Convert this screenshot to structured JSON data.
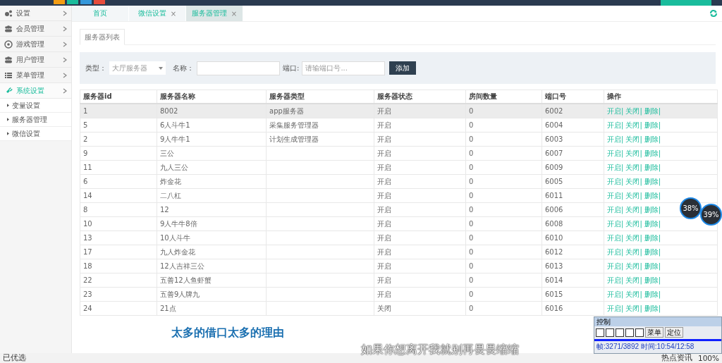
{
  "header": {
    "swatches": [
      {
        "color": "#f39c12"
      },
      {
        "color": "#1abc9c"
      },
      {
        "color": "#3498db"
      },
      {
        "color": "#e74c3c"
      }
    ]
  },
  "sidebar": {
    "items": [
      {
        "label": "设置",
        "kind": "gears",
        "selected": false
      },
      {
        "label": "会员管理",
        "kind": "users",
        "selected": false
      },
      {
        "label": "游戏管理",
        "kind": "ball",
        "selected": false
      },
      {
        "label": "用户管理",
        "kind": "users",
        "selected": false
      },
      {
        "label": "菜单管理",
        "kind": "list",
        "selected": false
      },
      {
        "label": "系统设置",
        "kind": "plug",
        "selected": true,
        "children": [
          {
            "label": "变量设置"
          },
          {
            "label": "服务器管理"
          },
          {
            "label": "微信设置"
          }
        ]
      }
    ]
  },
  "tabs": [
    {
      "label": "首页",
      "selected": false
    },
    {
      "label": "微信设置",
      "selected": false,
      "close": "×"
    },
    {
      "label": "服务器管理",
      "selected": true,
      "close": "×"
    }
  ],
  "panel_tab": "服务器列表",
  "filter": {
    "type_label": "类型：",
    "type_value": "大厅服务器",
    "name_label": "名称：",
    "port_label": "端口:",
    "port_placeholder": "请输端口号...",
    "add_button": "添加"
  },
  "table": {
    "columns": [
      "服务器id",
      "服务器名称",
      "服务器类型",
      "服务器状态",
      "房间数量",
      "端口号",
      "操作"
    ],
    "rows": [
      {
        "cells": [
          "1",
          "8002",
          "app服务器",
          "开启",
          "0",
          "6002"
        ],
        "actions": [
          "开启|",
          "关闭|",
          "删除|"
        ],
        "selected": true
      },
      {
        "cells": [
          "5",
          "6人斗牛1",
          "采集服务管理器",
          "开启",
          "0",
          "6004"
        ],
        "actions": [
          "开启|",
          "关闭|",
          "删除|"
        ],
        "selected": false
      },
      {
        "cells": [
          "2",
          "9人牛牛1",
          "计划生成管理器",
          "开启",
          "0",
          "6003"
        ],
        "actions": [
          "开启|",
          "关闭|",
          "删除|"
        ],
        "selected": false
      },
      {
        "cells": [
          "9",
          "三公",
          "",
          "开启",
          "0",
          "6007"
        ],
        "actions": [
          "开启|",
          "关闭|",
          "删除|"
        ],
        "selected": false
      },
      {
        "cells": [
          "11",
          "九人三公",
          "",
          "开启",
          "0",
          "6009"
        ],
        "actions": [
          "开启|",
          "关闭|",
          "删除|"
        ],
        "selected": false
      },
      {
        "cells": [
          "6",
          "炸金花",
          "",
          "开启",
          "0",
          "6005"
        ],
        "actions": [
          "开启|",
          "关闭|",
          "删除|"
        ],
        "selected": false
      },
      {
        "cells": [
          "14",
          "二八杠",
          "",
          "开启",
          "0",
          "6011"
        ],
        "actions": [
          "开启|",
          "关闭|",
          "删除|"
        ],
        "selected": false
      },
      {
        "cells": [
          "8",
          "12",
          "",
          "开启",
          "0",
          "6006"
        ],
        "actions": [
          "开启|",
          "关闭|",
          "删除|"
        ],
        "selected": false
      },
      {
        "cells": [
          "10",
          "9人牛牛8倍",
          "",
          "开启",
          "0",
          "6008"
        ],
        "actions": [
          "开启|",
          "关闭|",
          "删除|"
        ],
        "selected": false
      },
      {
        "cells": [
          "13",
          "10人斗牛",
          "",
          "开启",
          "0",
          "6010"
        ],
        "actions": [
          "开启|",
          "关闭|",
          "删除|"
        ],
        "selected": false
      },
      {
        "cells": [
          "17",
          "九人炸金花",
          "",
          "开启",
          "0",
          "6012"
        ],
        "actions": [
          "开启|",
          "关闭|",
          "删除|"
        ],
        "selected": false
      },
      {
        "cells": [
          "18",
          "12人吉祥三公",
          "",
          "开启",
          "0",
          "6013"
        ],
        "actions": [
          "开启|",
          "关闭|",
          "删除|"
        ],
        "selected": false
      },
      {
        "cells": [
          "22",
          "五善12人鱼虾蟹",
          "",
          "开启",
          "0",
          "6014"
        ],
        "actions": [
          "开启|",
          "关闭|",
          "删除|"
        ],
        "selected": false
      },
      {
        "cells": [
          "23",
          "五善9人牌九",
          "",
          "开启",
          "0",
          "6015"
        ],
        "actions": [
          "开启|",
          "关闭|",
          "删除|"
        ],
        "selected": false
      },
      {
        "cells": [
          "24",
          "21点",
          "",
          "关闭",
          "0",
          "6016"
        ],
        "actions": [
          "开启|",
          "关闭|",
          "删除|"
        ],
        "selected": false
      }
    ]
  },
  "gauges": [
    {
      "text": "38%"
    },
    {
      "text": "39%"
    }
  ],
  "subtitles": [
    "太多的借口太多的理由",
    "如果你想离开我就别再畏畏缩缩"
  ],
  "control_window": {
    "title": "控制",
    "buttons": [
      "菜单",
      "定位"
    ],
    "status": "帧:3271/3892 时间:10:54/12:58"
  },
  "status_bar": {
    "left": "已优选",
    "items": [
      "热点资讯",
      "100%"
    ]
  }
}
